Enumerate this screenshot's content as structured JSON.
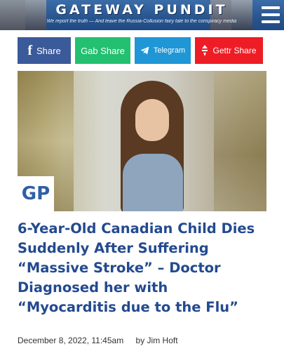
{
  "header": {
    "site_name": "GATEWAY PUNDIT",
    "tagline": "We report the truth — And leave the Russia-Collusion fairy tale to the conspiracy media"
  },
  "share_buttons": [
    {
      "label": "Share",
      "icon": "facebook-icon",
      "color": "#3b5a9a"
    },
    {
      "label": "Gab Share",
      "icon": "",
      "color": "#22c070"
    },
    {
      "label": "Telegram",
      "icon": "telegram-icon",
      "color": "#1f96d6"
    },
    {
      "label": "Gettr Share",
      "icon": "gettr-icon",
      "color": "#ee1c24"
    }
  ],
  "image_badge": "GP",
  "article": {
    "title": "6-Year-Old Canadian Child Dies Suddenly After Suffering “Massive Stroke” – Doctor Diagnosed her with “Myocarditis due to the Flu”",
    "date": "December 8, 2022, 11:45am",
    "author": "by Jim Hoft"
  },
  "colors": {
    "header_blue": "#2a5690",
    "title_blue": "#234a8f"
  }
}
